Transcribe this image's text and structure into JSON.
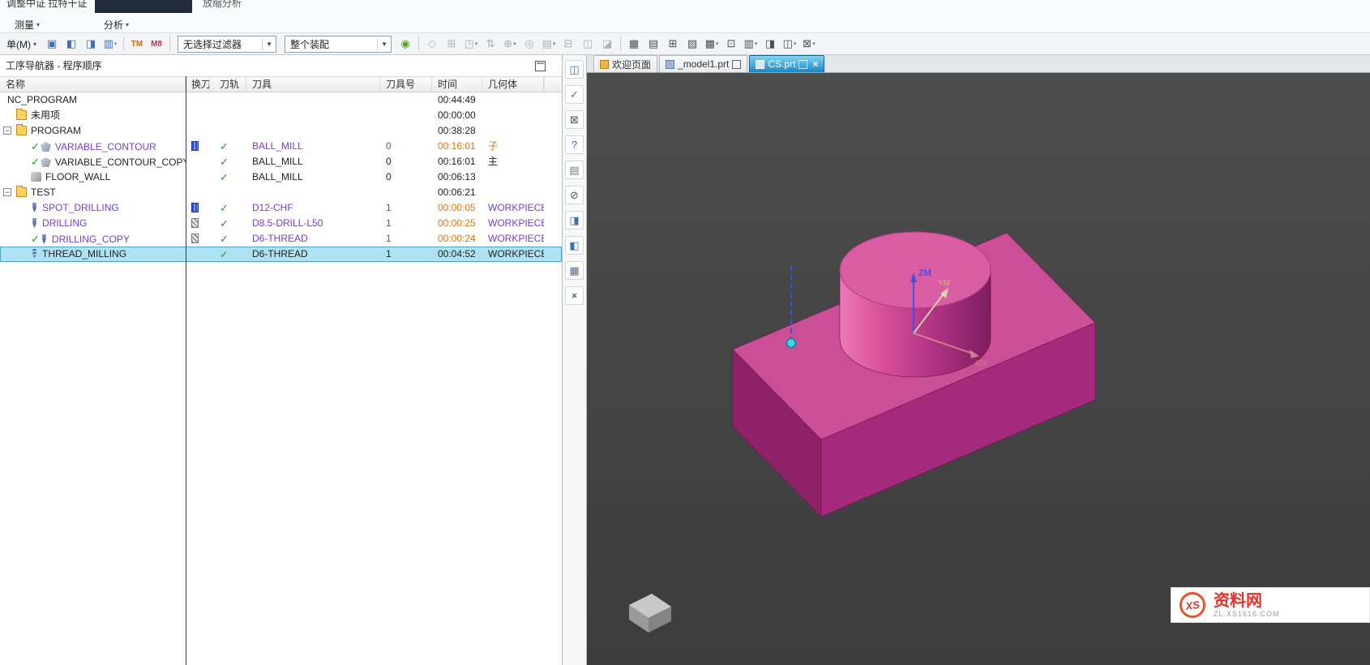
{
  "ribbon": {
    "clipped_top_text": "调整中证 拉特干证",
    "clipped_top_text2": "放缩分析",
    "measure_label": "测量",
    "analysis_label": "分析"
  },
  "menubar": {
    "menu_button": "单(M)"
  },
  "toolbar": {
    "filter_dropdown": "无选择过滤器",
    "scope_dropdown": "整个装配",
    "buttons_left": [
      {
        "g": "▣",
        "c": "#3e6fae"
      },
      {
        "g": "◧",
        "c": "#3e6fae"
      },
      {
        "g": "◨",
        "c": "#3e6fae"
      },
      {
        "g": "▥",
        "c": "#3e6fae",
        "caret": true
      },
      {
        "sep": true
      },
      {
        "g": "TM",
        "c": "#d06a00",
        "bold": true
      },
      {
        "g": "M8",
        "c": "#c23052",
        "bold": true
      },
      {
        "sep": true
      }
    ],
    "buttons_right": [
      {
        "g": "◉",
        "c": "#5aa032"
      },
      {
        "sep": true
      },
      {
        "g": "◇",
        "dim": true
      },
      {
        "g": "⊞",
        "dim": true
      },
      {
        "g": "◳",
        "dim": true,
        "caret": true
      },
      {
        "g": "⇅",
        "dim": true
      },
      {
        "g": "⊕",
        "dim": true,
        "caret": true
      },
      {
        "g": "◎",
        "dim": true
      },
      {
        "g": "▤",
        "dim": true,
        "caret": true
      },
      {
        "g": "⊟",
        "dim": true
      },
      {
        "g": "◫",
        "dim": true
      },
      {
        "g": "◪",
        "dim": true
      },
      {
        "sep": true
      },
      {
        "g": "▦",
        "c": "#4a4f55"
      },
      {
        "g": "▤",
        "c": "#4a4f55"
      },
      {
        "g": "⊞",
        "c": "#4a4f55"
      },
      {
        "g": "▧",
        "c": "#4a4f55"
      },
      {
        "g": "▩",
        "c": "#4a4f55",
        "caret": true
      },
      {
        "g": "⊡",
        "c": "#4a4f55"
      },
      {
        "g": "▥",
        "c": "#4a4f55",
        "caret": true
      },
      {
        "g": "◨",
        "c": "#4a4f55"
      },
      {
        "g": "◫",
        "c": "#4a4f55",
        "caret": true
      },
      {
        "g": "⊠",
        "c": "#4a4f55",
        "caret": true
      }
    ]
  },
  "navigator": {
    "title": "工序导航器 - 程序顺序",
    "columns": {
      "name": "名称",
      "toolchange": "换刀",
      "toolpath": "刀轨",
      "tool": "刀具",
      "toolno": "刀具号",
      "time": "时间",
      "geometry": "几何体"
    },
    "rows": [
      {
        "name": "NC_PROGRAM",
        "level": 0,
        "time": "00:44:49"
      },
      {
        "name": "未用项",
        "level": 1,
        "icon": "folder",
        "time": "00:00:00"
      },
      {
        "name": "PROGRAM",
        "level": 1,
        "icon": "folder",
        "expand": true,
        "time": "00:38:28"
      },
      {
        "name": "VARIABLE_CONTOUR",
        "level": 2,
        "check": true,
        "icon": "contour",
        "nameColor": "purple",
        "tc": "blue",
        "tp": true,
        "tool": "BALL_MILL",
        "toolColor": "purple",
        "tno": "0",
        "tnoColor": "purple",
        "time": "00:16:01",
        "timeColor": "orange",
        "geom": "子",
        "geomColor": "orange"
      },
      {
        "name": "VARIABLE_CONTOUR_COPY",
        "level": 2,
        "check": true,
        "icon": "contour",
        "tp": true,
        "tool": "BALL_MILL",
        "tno": "0",
        "time": "00:16:01",
        "geom": "主"
      },
      {
        "name": "FLOOR_WALL",
        "level": 2,
        "icon": "mill",
        "tp": true,
        "tool": "BALL_MILL",
        "tno": "0",
        "time": "00:06:13"
      },
      {
        "name": "TEST",
        "level": 1,
        "icon": "folder",
        "expand": true,
        "time": "00:06:21"
      },
      {
        "name": "SPOT_DRILLING",
        "level": 2,
        "icon": "drill",
        "nameColor": "purple",
        "tc": "blue",
        "tp": true,
        "tool": "D12-CHF",
        "toolColor": "purple",
        "tno": "1",
        "tnoColor": "purple",
        "time": "00:00:05",
        "timeColor": "orange",
        "geom": "WORKPIECE",
        "geomColor": "purple"
      },
      {
        "name": "DRILLING",
        "level": 2,
        "icon": "drill",
        "nameColor": "purple",
        "tc": "hatch",
        "tp": true,
        "tool": "D8.5-DRILL-L50",
        "toolColor": "purple",
        "tno": "1",
        "tnoColor": "purple",
        "time": "00:00:25",
        "timeColor": "orange",
        "geom": "WORKPIECE",
        "geomColor": "purple"
      },
      {
        "name": "DRILLING_COPY",
        "level": 2,
        "check": true,
        "icon": "drill",
        "nameColor": "purple",
        "tc": "hatch",
        "tp": true,
        "tool": "D6-THREAD",
        "toolColor": "purple",
        "tno": "1",
        "tnoColor": "purple",
        "time": "00:00:24",
        "timeColor": "orange",
        "geom": "WORKPIECE",
        "geomColor": "purple"
      },
      {
        "name": "THREAD_MILLING",
        "level": 2,
        "icon": "thread",
        "selected": true,
        "tp": true,
        "tool": "D6-THREAD",
        "tno": "1",
        "time": "00:04:52",
        "geom": "WORKPIECE"
      }
    ]
  },
  "resource_bar": {
    "icons": [
      {
        "g": "◫",
        "c": "#3e6fae"
      },
      {
        "g": "✓",
        "c": "#2aa02a"
      },
      {
        "g": "⊠",
        "c": "#555555"
      },
      {
        "g": "?",
        "c": "#2a6fd0"
      },
      {
        "g": "▤",
        "c": "#777777"
      },
      {
        "g": "⊘",
        "c": "#555555"
      },
      {
        "g": "◨",
        "c": "#3e6fae"
      },
      {
        "g": "◧",
        "c": "#3e6fae"
      },
      {
        "g": "▦",
        "c": "#3e6fae"
      },
      {
        "g": "×",
        "c": "#333333"
      }
    ]
  },
  "tabs": [
    {
      "label": "欢迎页面",
      "icon": "welcome"
    },
    {
      "label": "_model1.prt",
      "icon": "part",
      "aux": true
    },
    {
      "label": "CS.prt",
      "icon": "part",
      "aux": true,
      "close": "×",
      "active": true
    }
  ],
  "viewport": {
    "labels": {
      "z_axis": "ZM",
      "y_axis": "YM",
      "x_axis": "XM"
    }
  },
  "watermark": {
    "logo_text": "XS",
    "site_name": "资料网",
    "site_url": "ZL.XS1616.COM"
  }
}
